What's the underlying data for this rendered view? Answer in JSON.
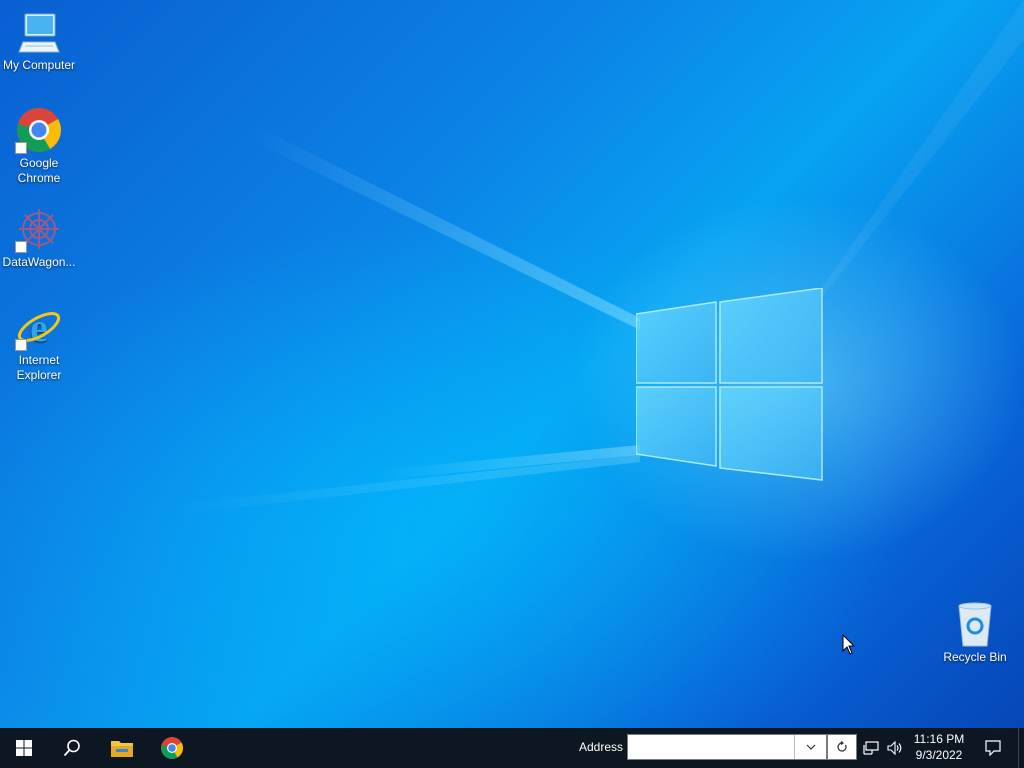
{
  "desktop": {
    "icons": [
      {
        "label": "My Computer",
        "icon": "computer-icon"
      },
      {
        "label": "Google Chrome",
        "icon": "chrome-icon"
      },
      {
        "label": "DataWagon...",
        "icon": "datawagon-icon"
      },
      {
        "label": "Internet Explorer",
        "icon": "internet-explorer-icon"
      },
      {
        "label": "Recycle Bin",
        "icon": "recycle-bin-icon"
      }
    ]
  },
  "taskbar": {
    "start_icon": "windows-start-icon",
    "search_icon": "search-icon",
    "pinned": [
      {
        "name": "File Explorer",
        "icon": "file-explorer-icon"
      },
      {
        "name": "Google Chrome",
        "icon": "chrome-icon"
      }
    ],
    "address": {
      "label": "Address",
      "value": ""
    },
    "tray_icons": [
      "network-icon",
      "volume-icon"
    ],
    "clock": {
      "time": "11:16 PM",
      "date": "9/3/2022"
    },
    "notification_icon": "notification-icon"
  },
  "colors": {
    "taskbar_bg": "#0c1722",
    "desktop_blue": "#0a6fd6",
    "light_blue": "#5fd4ff"
  }
}
